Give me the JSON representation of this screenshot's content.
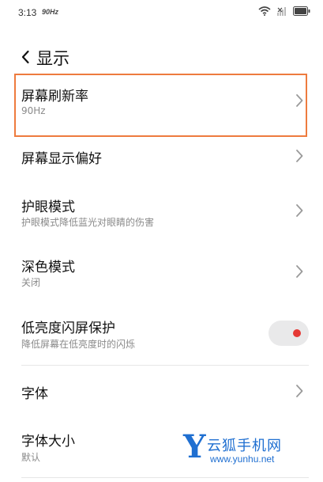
{
  "status_bar": {
    "time": "3:13",
    "refresh_badge": "90Hz",
    "icons": [
      "wifi-icon",
      "signal-off-icon",
      "battery-icon"
    ]
  },
  "header": {
    "back_icon": "chevron-left-icon",
    "title": "显示"
  },
  "settings": [
    {
      "title": "屏幕刷新率",
      "subtitle": "90Hz",
      "control": "chevron",
      "highlighted": true
    },
    {
      "title": "屏幕显示偏好",
      "subtitle": "",
      "control": "chevron"
    },
    {
      "title": "护眼模式",
      "subtitle": "护眼模式降低蓝光对眼睛的伤害",
      "control": "chevron"
    },
    {
      "title": "深色模式",
      "subtitle": "关闭",
      "control": "chevron"
    },
    {
      "title": "低亮度闪屏保护",
      "subtitle": "降低屏幕在低亮度时的闪烁",
      "control": "toggle",
      "toggle_on": false
    },
    {
      "title": "字体",
      "subtitle": "",
      "control": "chevron"
    },
    {
      "title": "字体大小",
      "subtitle": "默认",
      "control": "chevron"
    }
  ],
  "watermark": {
    "logo_letter": "Y",
    "name": "云狐手机网",
    "url": "www.yunhu.net"
  },
  "colors": {
    "highlight": "#ee7b3e",
    "toggle_dot": "#e53935",
    "watermark": "#1f6fd1"
  }
}
